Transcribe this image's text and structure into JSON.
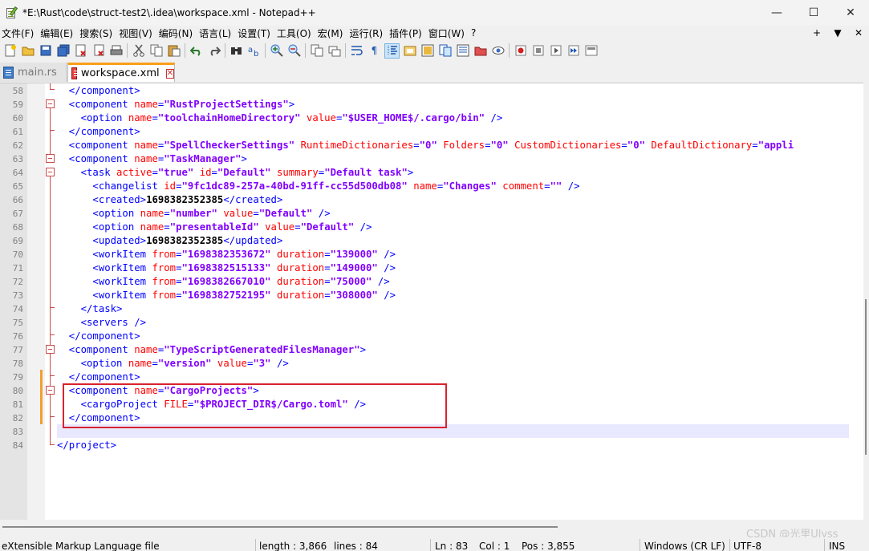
{
  "window": {
    "title": "*E:\\Rust\\code\\struct-test2\\.idea\\workspace.xml - Notepad++",
    "minimize": "—",
    "maximize": "☐",
    "close": "✕"
  },
  "menu": {
    "items": [
      "文件(F)",
      "编辑(E)",
      "搜索(S)",
      "视图(V)",
      "编码(N)",
      "语言(L)",
      "设置(T)",
      "工具(O)",
      "宏(M)",
      "运行(R)",
      "插件(P)",
      "窗口(W)",
      "?"
    ],
    "right": [
      "+",
      "▼",
      "✕"
    ]
  },
  "tabs": [
    {
      "label": "main.rs",
      "icon": "rust-file-icon"
    },
    {
      "label": "workspace.xml",
      "icon": "modified-file-icon",
      "close": "✕"
    }
  ],
  "editor": {
    "current_line": 83,
    "lines": [
      {
        "n": "58"
      },
      {
        "n": "59"
      },
      {
        "n": "60"
      },
      {
        "n": "61"
      },
      {
        "n": "62"
      },
      {
        "n": "63"
      },
      {
        "n": "64"
      },
      {
        "n": "65"
      },
      {
        "n": "66"
      },
      {
        "n": "67"
      },
      {
        "n": "68"
      },
      {
        "n": "69"
      },
      {
        "n": "70"
      },
      {
        "n": "71"
      },
      {
        "n": "72"
      },
      {
        "n": "73"
      },
      {
        "n": "74"
      },
      {
        "n": "75"
      },
      {
        "n": "76"
      },
      {
        "n": "77"
      },
      {
        "n": "78"
      },
      {
        "n": "79"
      },
      {
        "n": "80"
      },
      {
        "n": "81"
      },
      {
        "n": "82"
      },
      {
        "n": "83"
      },
      {
        "n": "84"
      }
    ],
    "code": [
      [
        [
          "tag",
          "  </component>"
        ]
      ],
      [
        [
          "tag",
          "  <component "
        ],
        [
          "attr",
          "name"
        ],
        [
          "tag",
          "="
        ],
        [
          "val",
          "\"RustProjectSettings\""
        ],
        [
          "tag",
          ">"
        ]
      ],
      [
        [
          "tag",
          "    <option "
        ],
        [
          "attr",
          "name"
        ],
        [
          "tag",
          "="
        ],
        [
          "val",
          "\"toolchainHomeDirectory\""
        ],
        [
          "tag",
          " "
        ],
        [
          "attr",
          "value"
        ],
        [
          "tag",
          "="
        ],
        [
          "val",
          "\"$USER_HOME$/.cargo/bin\""
        ],
        [
          "tag",
          " />"
        ]
      ],
      [
        [
          "tag",
          "  </component>"
        ]
      ],
      [
        [
          "tag",
          "  <component "
        ],
        [
          "attr",
          "name"
        ],
        [
          "tag",
          "="
        ],
        [
          "val",
          "\"SpellCheckerSettings\""
        ],
        [
          "tag",
          " "
        ],
        [
          "attr",
          "RuntimeDictionaries"
        ],
        [
          "tag",
          "="
        ],
        [
          "val",
          "\"0\""
        ],
        [
          "tag",
          " "
        ],
        [
          "attr",
          "Folders"
        ],
        [
          "tag",
          "="
        ],
        [
          "val",
          "\"0\""
        ],
        [
          "tag",
          " "
        ],
        [
          "attr",
          "CustomDictionaries"
        ],
        [
          "tag",
          "="
        ],
        [
          "val",
          "\"0\""
        ],
        [
          "tag",
          " "
        ],
        [
          "attr",
          "DefaultDictionary"
        ],
        [
          "tag",
          "="
        ],
        [
          "val",
          "\"appli"
        ]
      ],
      [
        [
          "tag",
          "  <component "
        ],
        [
          "attr",
          "name"
        ],
        [
          "tag",
          "="
        ],
        [
          "val",
          "\"TaskManager\""
        ],
        [
          "tag",
          ">"
        ]
      ],
      [
        [
          "tag",
          "    <task "
        ],
        [
          "attr",
          "active"
        ],
        [
          "tag",
          "="
        ],
        [
          "val",
          "\"true\""
        ],
        [
          "tag",
          " "
        ],
        [
          "attr",
          "id"
        ],
        [
          "tag",
          "="
        ],
        [
          "val",
          "\"Default\""
        ],
        [
          "tag",
          " "
        ],
        [
          "attr",
          "summary"
        ],
        [
          "tag",
          "="
        ],
        [
          "val",
          "\"Default task\""
        ],
        [
          "tag",
          ">"
        ]
      ],
      [
        [
          "tag",
          "      <changelist "
        ],
        [
          "attr",
          "id"
        ],
        [
          "tag",
          "="
        ],
        [
          "val",
          "\"9fc1dc89-257a-40bd-91ff-cc55d500db08\""
        ],
        [
          "tag",
          " "
        ],
        [
          "attr",
          "name"
        ],
        [
          "tag",
          "="
        ],
        [
          "val",
          "\"Changes\""
        ],
        [
          "tag",
          " "
        ],
        [
          "attr",
          "comment"
        ],
        [
          "tag",
          "="
        ],
        [
          "val",
          "\"\""
        ],
        [
          "tag",
          " />"
        ]
      ],
      [
        [
          "tag",
          "      <created>"
        ],
        [
          "txt",
          "1698382352385"
        ],
        [
          "tag",
          "</created>"
        ]
      ],
      [
        [
          "tag",
          "      <option "
        ],
        [
          "attr",
          "name"
        ],
        [
          "tag",
          "="
        ],
        [
          "val",
          "\"number\""
        ],
        [
          "tag",
          " "
        ],
        [
          "attr",
          "value"
        ],
        [
          "tag",
          "="
        ],
        [
          "val",
          "\"Default\""
        ],
        [
          "tag",
          " />"
        ]
      ],
      [
        [
          "tag",
          "      <option "
        ],
        [
          "attr",
          "name"
        ],
        [
          "tag",
          "="
        ],
        [
          "val",
          "\"presentableId\""
        ],
        [
          "tag",
          " "
        ],
        [
          "attr",
          "value"
        ],
        [
          "tag",
          "="
        ],
        [
          "val",
          "\"Default\""
        ],
        [
          "tag",
          " />"
        ]
      ],
      [
        [
          "tag",
          "      <updated>"
        ],
        [
          "txt",
          "1698382352385"
        ],
        [
          "tag",
          "</updated>"
        ]
      ],
      [
        [
          "tag",
          "      <workItem "
        ],
        [
          "attr",
          "from"
        ],
        [
          "tag",
          "="
        ],
        [
          "val",
          "\"1698382353672\""
        ],
        [
          "tag",
          " "
        ],
        [
          "attr",
          "duration"
        ],
        [
          "tag",
          "="
        ],
        [
          "val",
          "\"139000\""
        ],
        [
          "tag",
          " />"
        ]
      ],
      [
        [
          "tag",
          "      <workItem "
        ],
        [
          "attr",
          "from"
        ],
        [
          "tag",
          "="
        ],
        [
          "val",
          "\"1698382515133\""
        ],
        [
          "tag",
          " "
        ],
        [
          "attr",
          "duration"
        ],
        [
          "tag",
          "="
        ],
        [
          "val",
          "\"149000\""
        ],
        [
          "tag",
          " />"
        ]
      ],
      [
        [
          "tag",
          "      <workItem "
        ],
        [
          "attr",
          "from"
        ],
        [
          "tag",
          "="
        ],
        [
          "val",
          "\"1698382667010\""
        ],
        [
          "tag",
          " "
        ],
        [
          "attr",
          "duration"
        ],
        [
          "tag",
          "="
        ],
        [
          "val",
          "\"75000\""
        ],
        [
          "tag",
          " />"
        ]
      ],
      [
        [
          "tag",
          "      <workItem "
        ],
        [
          "attr",
          "from"
        ],
        [
          "tag",
          "="
        ],
        [
          "val",
          "\"1698382752195\""
        ],
        [
          "tag",
          " "
        ],
        [
          "attr",
          "duration"
        ],
        [
          "tag",
          "="
        ],
        [
          "val",
          "\"308000\""
        ],
        [
          "tag",
          " />"
        ]
      ],
      [
        [
          "tag",
          "    </task>"
        ]
      ],
      [
        [
          "tag",
          "    <servers />"
        ]
      ],
      [
        [
          "tag",
          "  </component>"
        ]
      ],
      [
        [
          "tag",
          "  <component "
        ],
        [
          "attr",
          "name"
        ],
        [
          "tag",
          "="
        ],
        [
          "val",
          "\"TypeScriptGeneratedFilesManager\""
        ],
        [
          "tag",
          ">"
        ]
      ],
      [
        [
          "tag",
          "    <option "
        ],
        [
          "attr",
          "name"
        ],
        [
          "tag",
          "="
        ],
        [
          "val",
          "\"version\""
        ],
        [
          "tag",
          " "
        ],
        [
          "attr",
          "value"
        ],
        [
          "tag",
          "="
        ],
        [
          "val",
          "\"3\""
        ],
        [
          "tag",
          " />"
        ]
      ],
      [
        [
          "tag",
          "  </component>"
        ]
      ],
      [
        [
          "tag",
          "  <component "
        ],
        [
          "attr",
          "name"
        ],
        [
          "tag",
          "="
        ],
        [
          "val",
          "\"CargoProjects\""
        ],
        [
          "tag",
          ">"
        ]
      ],
      [
        [
          "tag",
          "    <cargoProject "
        ],
        [
          "attr",
          "FILE"
        ],
        [
          "tag",
          "="
        ],
        [
          "val",
          "\"$PROJECT_DIR$/Cargo.toml\""
        ],
        [
          "tag",
          " />"
        ]
      ],
      [
        [
          "tag",
          "  </component>"
        ]
      ],
      [],
      [
        [
          "tag",
          "</project>"
        ]
      ]
    ]
  },
  "status": {
    "file_type": "eXtensible Markup Language file",
    "length": "length : 3,866",
    "lines": "lines : 84",
    "ln": "Ln : 83",
    "col": "Col : 1",
    "pos": "Pos : 3,855",
    "eol": "Windows (CR LF)",
    "encoding": "UTF-8",
    "mode": "INS"
  },
  "watermark": "CSDN @光里Ulyss",
  "colors": {
    "tag": "#0000ff",
    "attr": "#ff0000",
    "value": "#8000ff",
    "highlight_box": "#d9232e",
    "current_line": "#e8e8ff"
  }
}
